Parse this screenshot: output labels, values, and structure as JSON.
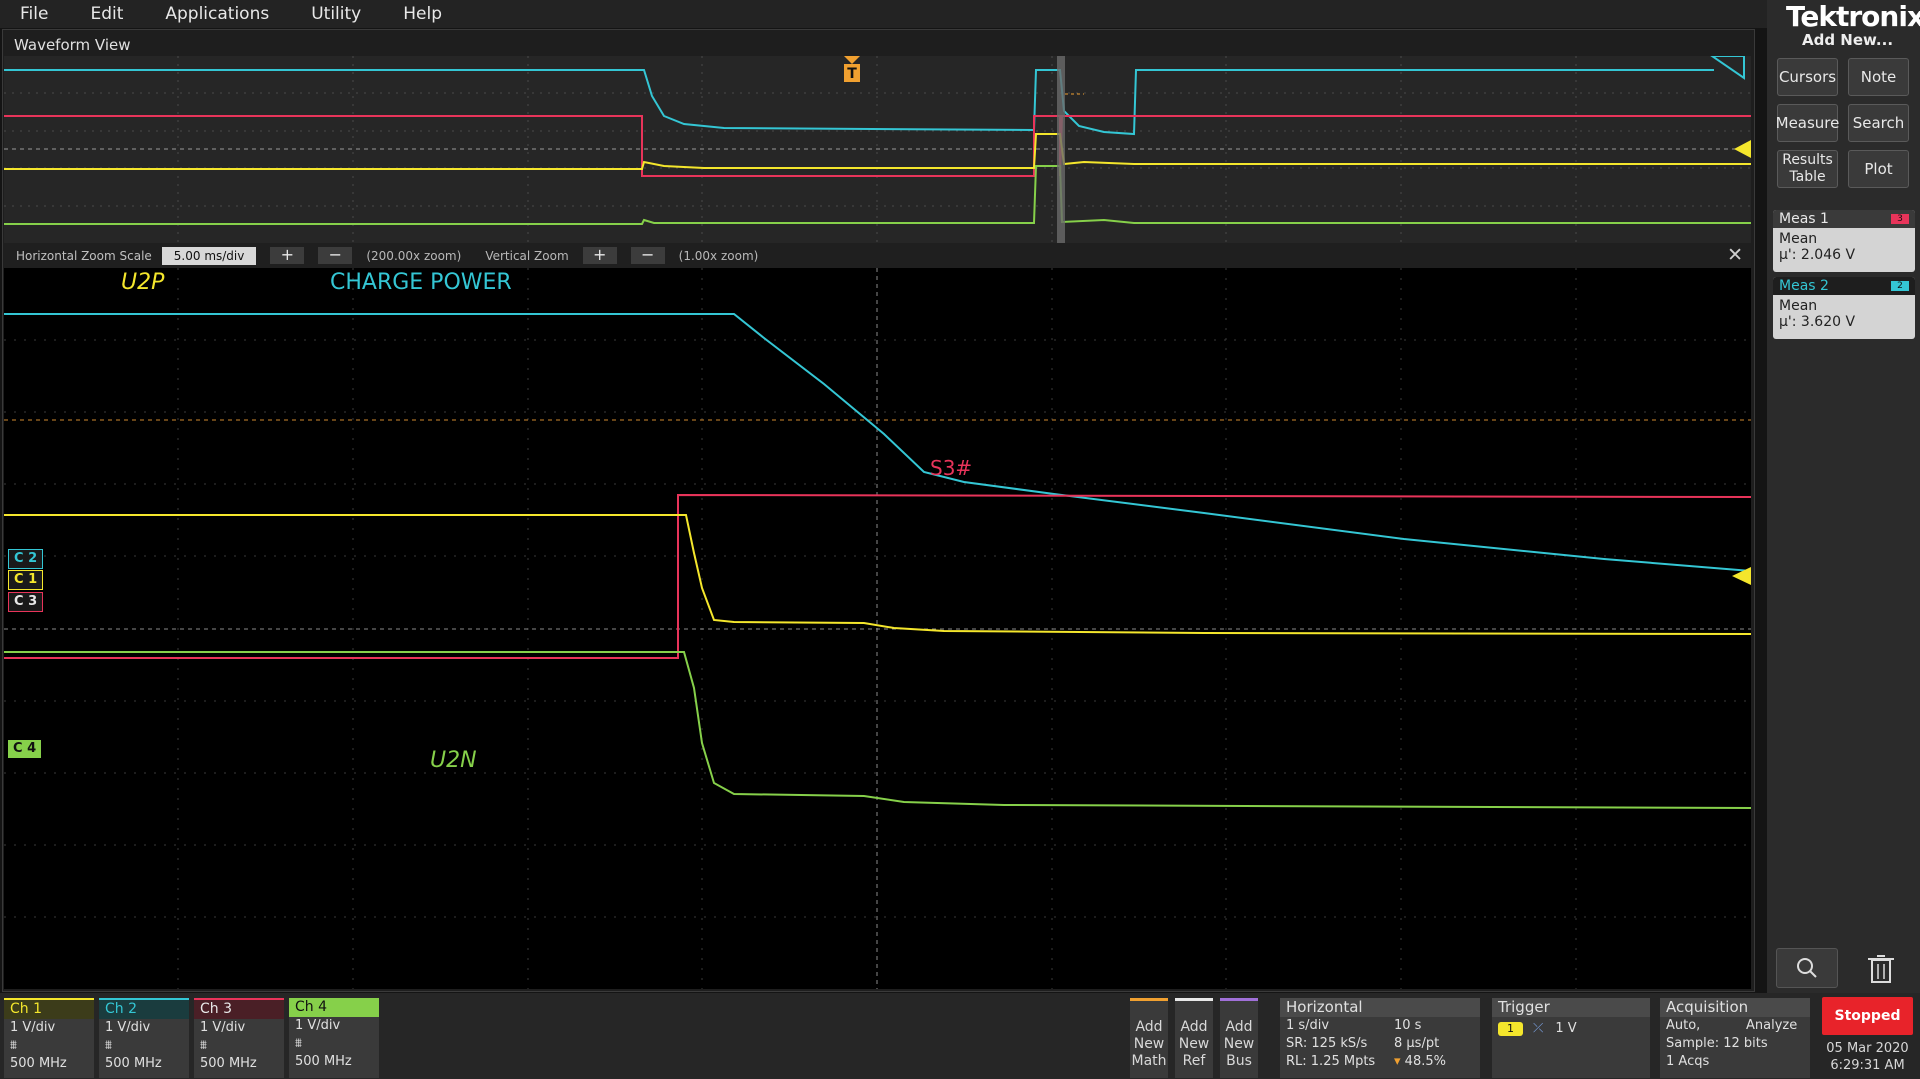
{
  "menu": [
    "File",
    "Edit",
    "Applications",
    "Utility",
    "Help"
  ],
  "waveform_view": {
    "title": "Waveform View",
    "zoom": {
      "hz_label": "Horizontal Zoom Scale",
      "hz_value": "5.00 ms/div",
      "hz_factor": "(200.00x zoom)",
      "vt_label": "Vertical Zoom",
      "vt_factor": "(1.00x zoom)"
    },
    "trigger_marker": "T",
    "labels": {
      "u2p": "U2P",
      "charge_power": "CHARGE POWER",
      "s3": "S3#",
      "u2n": "U2N"
    },
    "channel_tags": {
      "c1": "C 1",
      "c2": "C 2",
      "c3": "C 3",
      "c4": "C 4"
    }
  },
  "right_panel": {
    "logo": "Tektronix",
    "add_new": "Add New...",
    "buttons": [
      "Cursors",
      "Note",
      "Measure",
      "Search",
      "Results Table",
      "Plot"
    ],
    "measurements": [
      {
        "name": "Meas 1",
        "badge": "3",
        "type": "Mean",
        "value": "µ': 2.046 V"
      },
      {
        "name": "Meas 2",
        "badge": "2",
        "type": "Mean",
        "value": "µ': 3.620 V"
      }
    ]
  },
  "channels": [
    {
      "name": "Ch 1",
      "scale": "1 V/div",
      "bw": "500 MHz",
      "color": "#f4e62c"
    },
    {
      "name": "Ch 2",
      "scale": "1 V/div",
      "bw": "500 MHz",
      "color": "#34c6d4"
    },
    {
      "name": "Ch 3",
      "scale": "1 V/div",
      "bw": "500 MHz",
      "color": "#e8345a"
    },
    {
      "name": "Ch 4",
      "scale": "1 V/div",
      "bw": "500 MHz",
      "color": "#86d04a"
    }
  ],
  "add_buttons": [
    {
      "l1": "Add",
      "l2": "New",
      "l3": "Math"
    },
    {
      "l1": "Add",
      "l2": "New",
      "l3": "Ref"
    },
    {
      "l1": "Add",
      "l2": "New",
      "l3": "Bus"
    }
  ],
  "horizontal": {
    "title": "Horizontal",
    "scale": "1 s/div",
    "duration": "10 s",
    "sr": "SR: 125 kS/s",
    "rate": "8 µs/pt",
    "rl": "RL: 1.25 Mpts",
    "pos": "48.5%"
  },
  "trigger": {
    "title": "Trigger",
    "source": "1",
    "level": "1 V"
  },
  "acquisition": {
    "title": "Acquisition",
    "mode": "Auto,",
    "analyze": "Analyze",
    "sample": "Sample: 12 bits",
    "acqs": "1 Acqs"
  },
  "status": "Stopped",
  "date": "05 Mar 2020",
  "time": "6:29:31 AM"
}
